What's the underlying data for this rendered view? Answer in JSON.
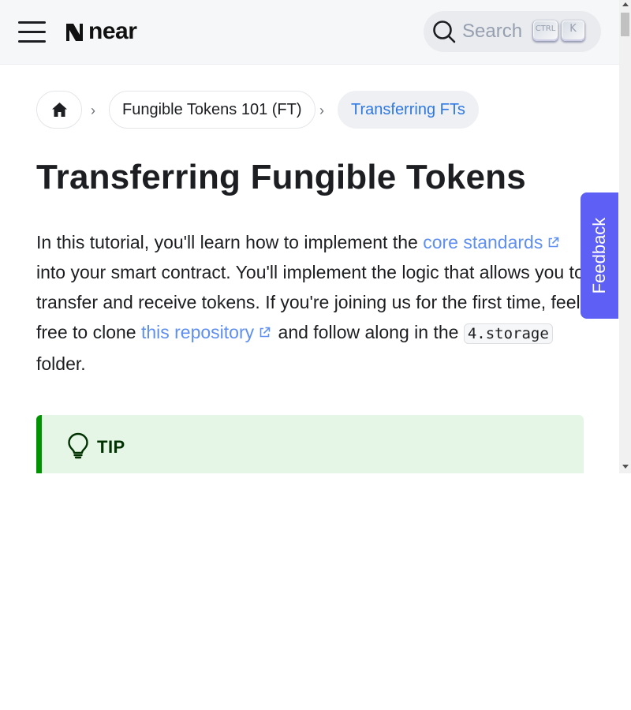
{
  "navbar": {
    "logo_text": "near",
    "search": {
      "placeholder": "Search",
      "shortcut_modifier": "CTRL",
      "shortcut_key": "K"
    }
  },
  "breadcrumb": {
    "items": [
      {
        "label": "Fungible Tokens 101 (FT)"
      },
      {
        "label": "Transferring FTs"
      }
    ]
  },
  "article": {
    "title": "Transferring Fungible Tokens",
    "intro": {
      "before_link1": "In this tutorial, you'll learn how to implement the ",
      "link1": "core standards",
      "after_link1": " into your smart contract. You'll implement the logic that allows you to transfer and receive tokens. If you're joining us for the first time, feel free to clone ",
      "link2": "this repository",
      "after_link2": " and follow along in the ",
      "code": "4.storage",
      "after_code": " folder."
    },
    "tip": {
      "label": "TIP"
    }
  },
  "feedback_label": "Feedback",
  "colors": {
    "link": "#5f8ff0",
    "accent_blue": "#2e78e4",
    "tip_border": "#009400",
    "tip_background": "#e6f6e6",
    "feedback_background": "#5d5ff5"
  },
  "icons": [
    "menu-icon",
    "near-logo-icon",
    "search-icon",
    "home-icon",
    "chevron-right-icon",
    "external-link-icon",
    "lightbulb-icon"
  ]
}
